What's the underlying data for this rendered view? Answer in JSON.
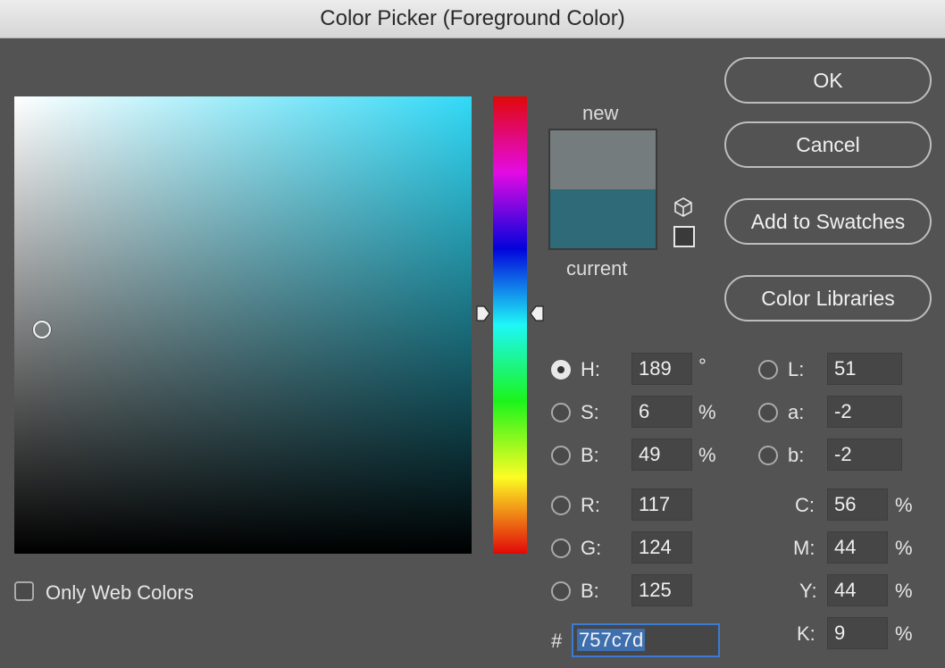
{
  "window": {
    "title": "Color Picker (Foreground Color)"
  },
  "buttons": {
    "ok": "OK",
    "cancel": "Cancel",
    "add_to_swatches": "Add to Swatches",
    "color_libraries": "Color Libraries"
  },
  "swatch": {
    "new_label": "new",
    "current_label": "current",
    "new_color": "#757c7d",
    "current_color": "#2e6a78"
  },
  "hsb": {
    "h": {
      "label": "H:",
      "value": "189",
      "unit": "°"
    },
    "s": {
      "label": "S:",
      "value": "6",
      "unit": "%"
    },
    "b": {
      "label": "B:",
      "value": "49",
      "unit": "%"
    }
  },
  "rgb": {
    "r": {
      "label": "R:",
      "value": "117"
    },
    "g": {
      "label": "G:",
      "value": "124"
    },
    "b": {
      "label": "B:",
      "value": "125"
    }
  },
  "lab": {
    "l": {
      "label": "L:",
      "value": "51"
    },
    "a": {
      "label": "a:",
      "value": "-2"
    },
    "b": {
      "label": "b:",
      "value": "-2"
    }
  },
  "cmyk": {
    "c": {
      "label": "C:",
      "value": "56",
      "unit": "%"
    },
    "m": {
      "label": "M:",
      "value": "44",
      "unit": "%"
    },
    "y": {
      "label": "Y:",
      "value": "44",
      "unit": "%"
    },
    "k": {
      "label": "K:",
      "value": "9",
      "unit": "%"
    }
  },
  "hex": {
    "label": "#",
    "value": "757c7d"
  },
  "web_colors": {
    "label": "Only Web Colors",
    "checked": false
  },
  "selected_mode": "H",
  "color_field": {
    "hue_degrees": 189,
    "saturation_percent": 6,
    "brightness_percent": 49
  },
  "icons": {
    "out_of_gamut": "cube-icon",
    "web_safe": "square-icon"
  }
}
